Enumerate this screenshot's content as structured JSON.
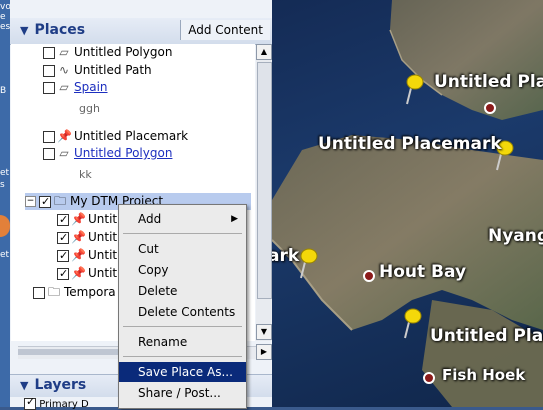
{
  "desktop": {
    "labels": [
      "vo",
      "e",
      "es",
      "B",
      "et",
      "s",
      "et"
    ]
  },
  "places": {
    "title": "Places",
    "add_content": "Add Content",
    "items": [
      {
        "label": "Untitled Polygon",
        "icon": "polygon-icon",
        "checked": false,
        "link": false
      },
      {
        "label": "Untitled Path",
        "icon": "path-icon",
        "checked": false,
        "link": false
      },
      {
        "label": "Spain",
        "icon": "polygon-icon",
        "checked": false,
        "link": true
      },
      {
        "label": "ggh",
        "desc": true
      },
      {
        "label": "Untitled Placemark",
        "icon": "orange-pushpin-icon",
        "checked": false,
        "link": false
      },
      {
        "label": "Untitled Polygon",
        "icon": "polygon-icon",
        "checked": false,
        "link": true
      },
      {
        "label": "kk",
        "desc": true
      },
      {
        "label": "My DTM Project",
        "icon": "folder-icon",
        "checked": true,
        "selected": true
      },
      {
        "label": "Untit",
        "icon": "yellow-pushpin-icon",
        "checked": true
      },
      {
        "label": "Untit",
        "icon": "yellow-pushpin-icon",
        "checked": true
      },
      {
        "label": "Untit",
        "icon": "yellow-pushpin-icon",
        "checked": true
      },
      {
        "label": "Untit",
        "icon": "yellow-pushpin-icon",
        "checked": true
      },
      {
        "label": "Tempora",
        "icon": "folder-icon",
        "checked": false
      }
    ]
  },
  "layers": {
    "title": "Layers",
    "row_label": "Primary D"
  },
  "map": {
    "labels": {
      "untitled_place_top": "Untitled Place",
      "untitled_placemark": "Untitled Placemark",
      "nyang": "Nyang",
      "ark": "ark",
      "hout_bay": "Hout Bay",
      "untitled_place_bottom": "Untitled Place",
      "fish_hoek": "Fish Hoek"
    }
  },
  "context_menu": {
    "items": [
      "Add",
      "Cut",
      "Copy",
      "Delete",
      "Delete Contents",
      "Rename",
      "Save Place As...",
      "Share / Post..."
    ],
    "highlighted": "Save Place As..."
  }
}
